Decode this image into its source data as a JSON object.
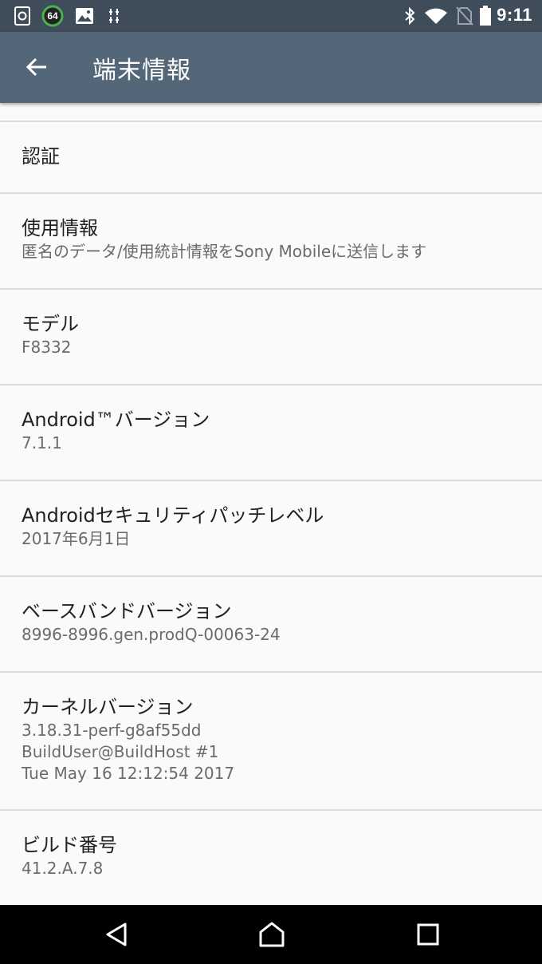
{
  "status_bar": {
    "time": "9:11",
    "notif_badge": "64",
    "icons": [
      "sync-icon",
      "badge-64-icon",
      "image-icon",
      "usb-debug-icon",
      "bluetooth-icon",
      "wifi-icon",
      "no-sim-icon",
      "battery-icon"
    ]
  },
  "app_bar": {
    "title": "端末情報",
    "back_icon": "arrow-back-icon"
  },
  "items": [
    {
      "title": "認証",
      "subtitle": ""
    },
    {
      "title": "使用情報",
      "subtitle": "匿名のデータ/使用統計情報をSony Mobileに送信します"
    },
    {
      "title": "モデル",
      "subtitle": "F8332"
    },
    {
      "title": "Android™バージョン",
      "subtitle": "7.1.1"
    },
    {
      "title": "Androidセキュリティパッチレベル",
      "subtitle": "2017年6月1日"
    },
    {
      "title": "ベースバンドバージョン",
      "subtitle": "8996-8996.gen.prodQ-00063-24"
    },
    {
      "title": "カーネルバージョン",
      "subtitle": "3.18.31-perf-g8af55dd\nBuildUser@BuildHost #1\nTue May 16 12:12:54 2017"
    },
    {
      "title": "ビルド番号",
      "subtitle": "41.2.A.7.8"
    }
  ],
  "nav_bar": {
    "icons": [
      "back-triangle-icon",
      "home-icon",
      "recents-icon"
    ]
  }
}
